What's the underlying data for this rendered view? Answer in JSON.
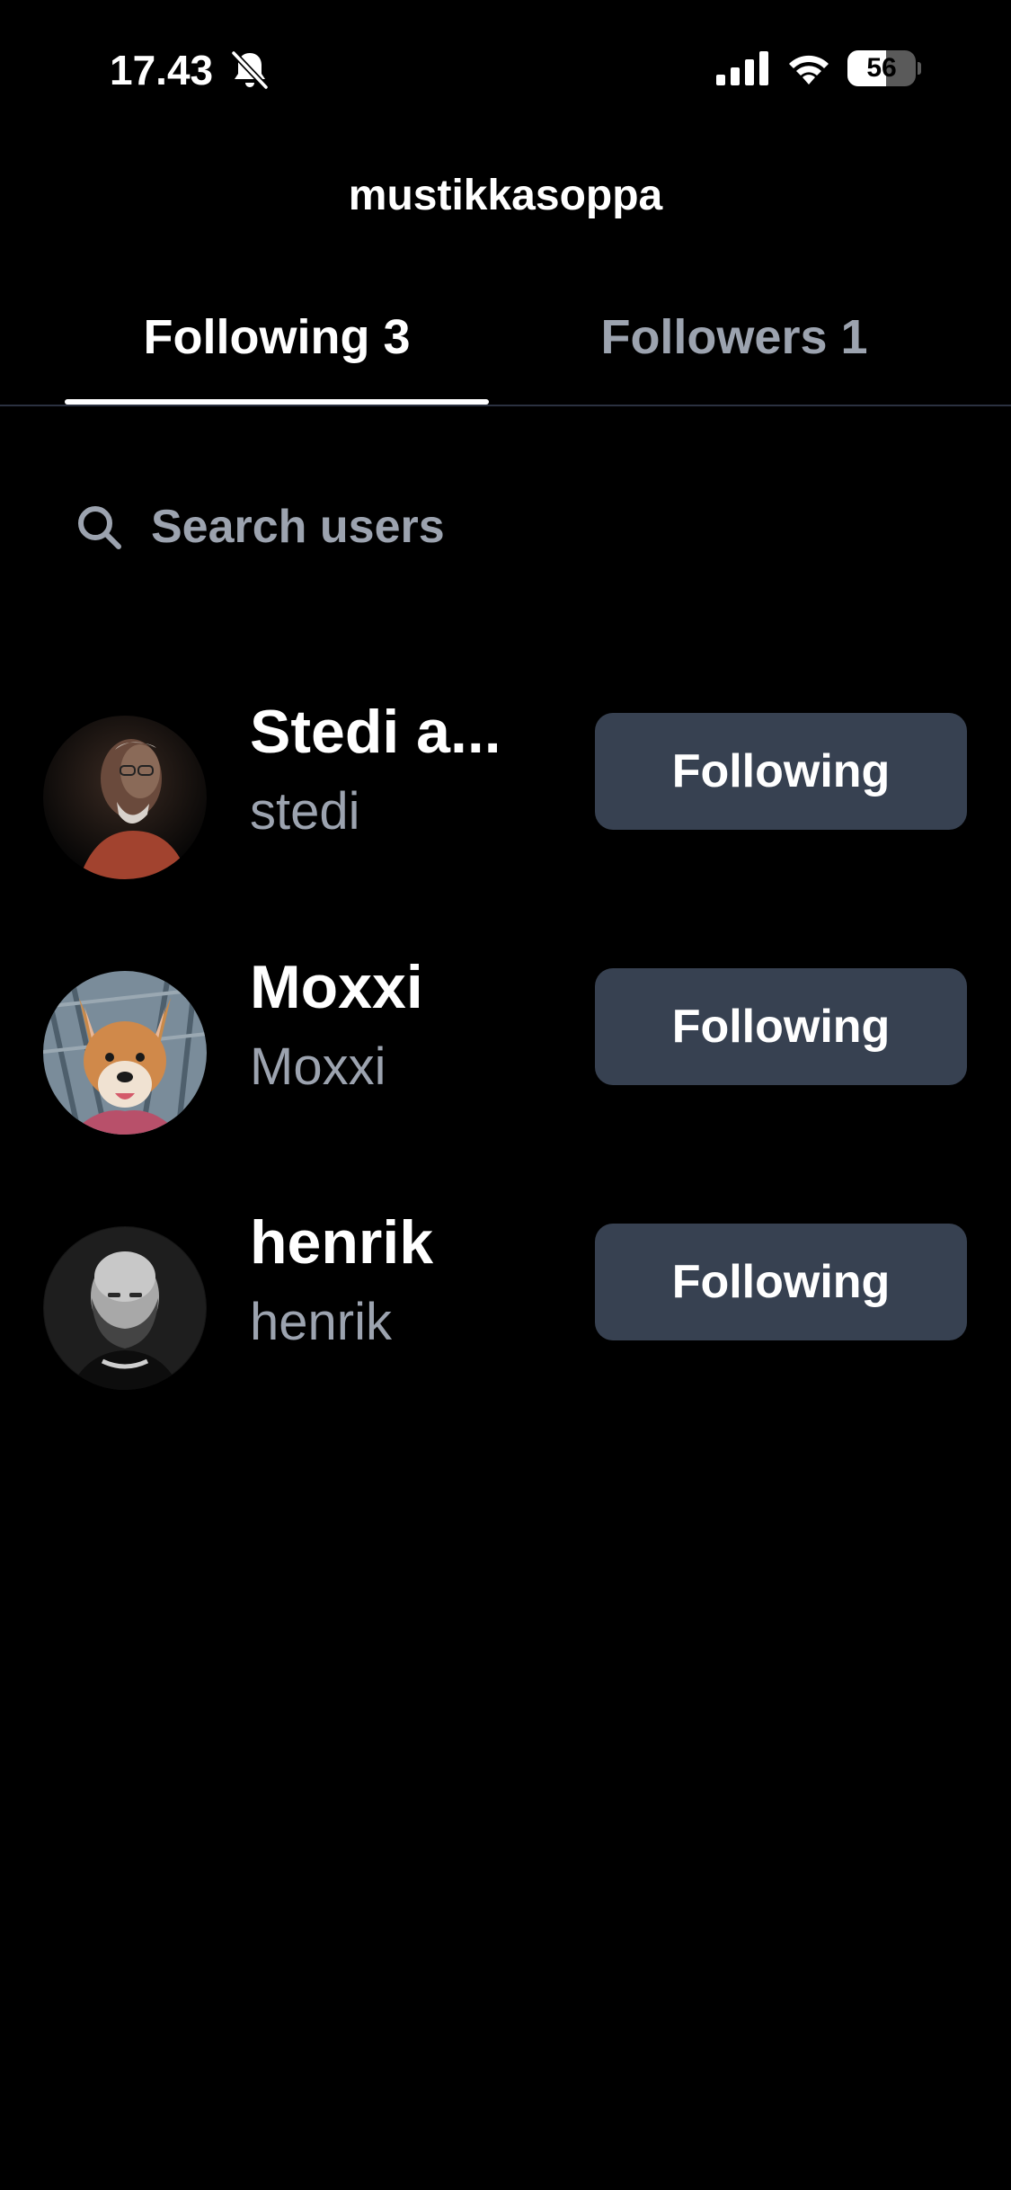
{
  "status_bar": {
    "time": "17.43",
    "battery_level": "56",
    "battery_fraction": 0.56,
    "icons": [
      "bell-off-icon",
      "signal-icon",
      "wifi-icon",
      "battery-icon"
    ]
  },
  "header": {
    "title": "mustikkasoppa"
  },
  "tabs": [
    {
      "label": "Following 3",
      "active": true
    },
    {
      "label": "Followers 1",
      "active": false
    }
  ],
  "search": {
    "placeholder": "Search users",
    "value": "",
    "icon": "search-icon"
  },
  "users": [
    {
      "name": "Stedi a...",
      "handle": "stedi",
      "button_label": "Following",
      "avatar": "man-glasses-beard-photo"
    },
    {
      "name": "Moxxi",
      "handle": "Moxxi",
      "button_label": "Following",
      "avatar": "corgi-dog-photo"
    },
    {
      "name": "henrik",
      "handle": "henrik",
      "button_label": "Following",
      "avatar": "bald-bearded-man-bw-photo"
    }
  ],
  "colors": {
    "background": "#000000",
    "text_primary": "#ffffff",
    "text_secondary": "#9ca3af",
    "button_bg": "#374151",
    "divider": "#2b3140"
  }
}
